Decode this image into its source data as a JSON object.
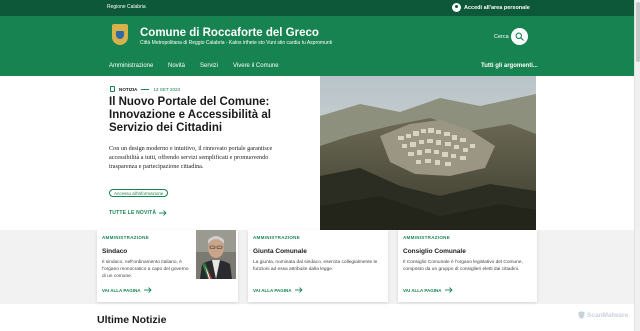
{
  "slim_header": {
    "region": "Regione Calabria",
    "login": "Accedi all'area personale"
  },
  "header": {
    "title": "Comune di Roccaforte del Greco",
    "subtitle": "Città Metropolitana di Reggio Calabria - Kalos irthete sto Vuni stin cardia tu Aspromunti",
    "search_label": "Cerca"
  },
  "nav": {
    "items": [
      "Amministrazione",
      "Novità",
      "Servizi",
      "Vivere il Comune"
    ],
    "all_topics": "Tutti gli argomenti..."
  },
  "hero": {
    "category": "NOTIZIA",
    "date": "13 SET 2023",
    "title": "Il Nuovo Portale del Comune: Innovazione e Accessibilità al Servizio dei Cittadini",
    "text": "Con un design moderno e intuitivo, il rinnovato portale garantisce accessibilità a tutti, offrendo servizi semplificati e promuovendo trasparenza e partecipazione cittadina.",
    "tag": "Accesso all'informazione",
    "all_news": "TUTTE LE NOVITÀ"
  },
  "cards": [
    {
      "kicker": "AMMINISTRAZIONE",
      "title": "Sindaco",
      "text": "Il sindaco, nell'ordinamento italiano, è l'organo monocratico a capo del governo di un comune.",
      "link": "VAI ALLA PAGINA"
    },
    {
      "kicker": "AMMINISTRAZIONE",
      "title": "Giunta Comunale",
      "text": "La giunta, nominata dal sindaco, esercita collegialmente le funzioni ad essa attribuite dalla legge.",
      "link": "VAI ALLA PAGINA"
    },
    {
      "kicker": "AMMINISTRAZIONE",
      "title": "Consiglio Comunale",
      "text": "Il Consiglio Comunale è l'organo legislativo del Comune, composto da un gruppo di consiglieri eletti dai cittadini.",
      "link": "VAI ALLA PAGINA"
    }
  ],
  "section": {
    "title": "Ultime Notizie"
  },
  "watermark": "ScanMalware",
  "icons": {
    "login": "user-circle-icon",
    "search": "search-icon",
    "arrow": "arrow-right-icon",
    "category": "document-icon",
    "crest": "coat-of-arms-icon"
  },
  "colors": {
    "primary": "#178350",
    "dark": "#0d5838",
    "text": "#1a1a1a",
    "muted_bg": "#f2f2f2"
  }
}
